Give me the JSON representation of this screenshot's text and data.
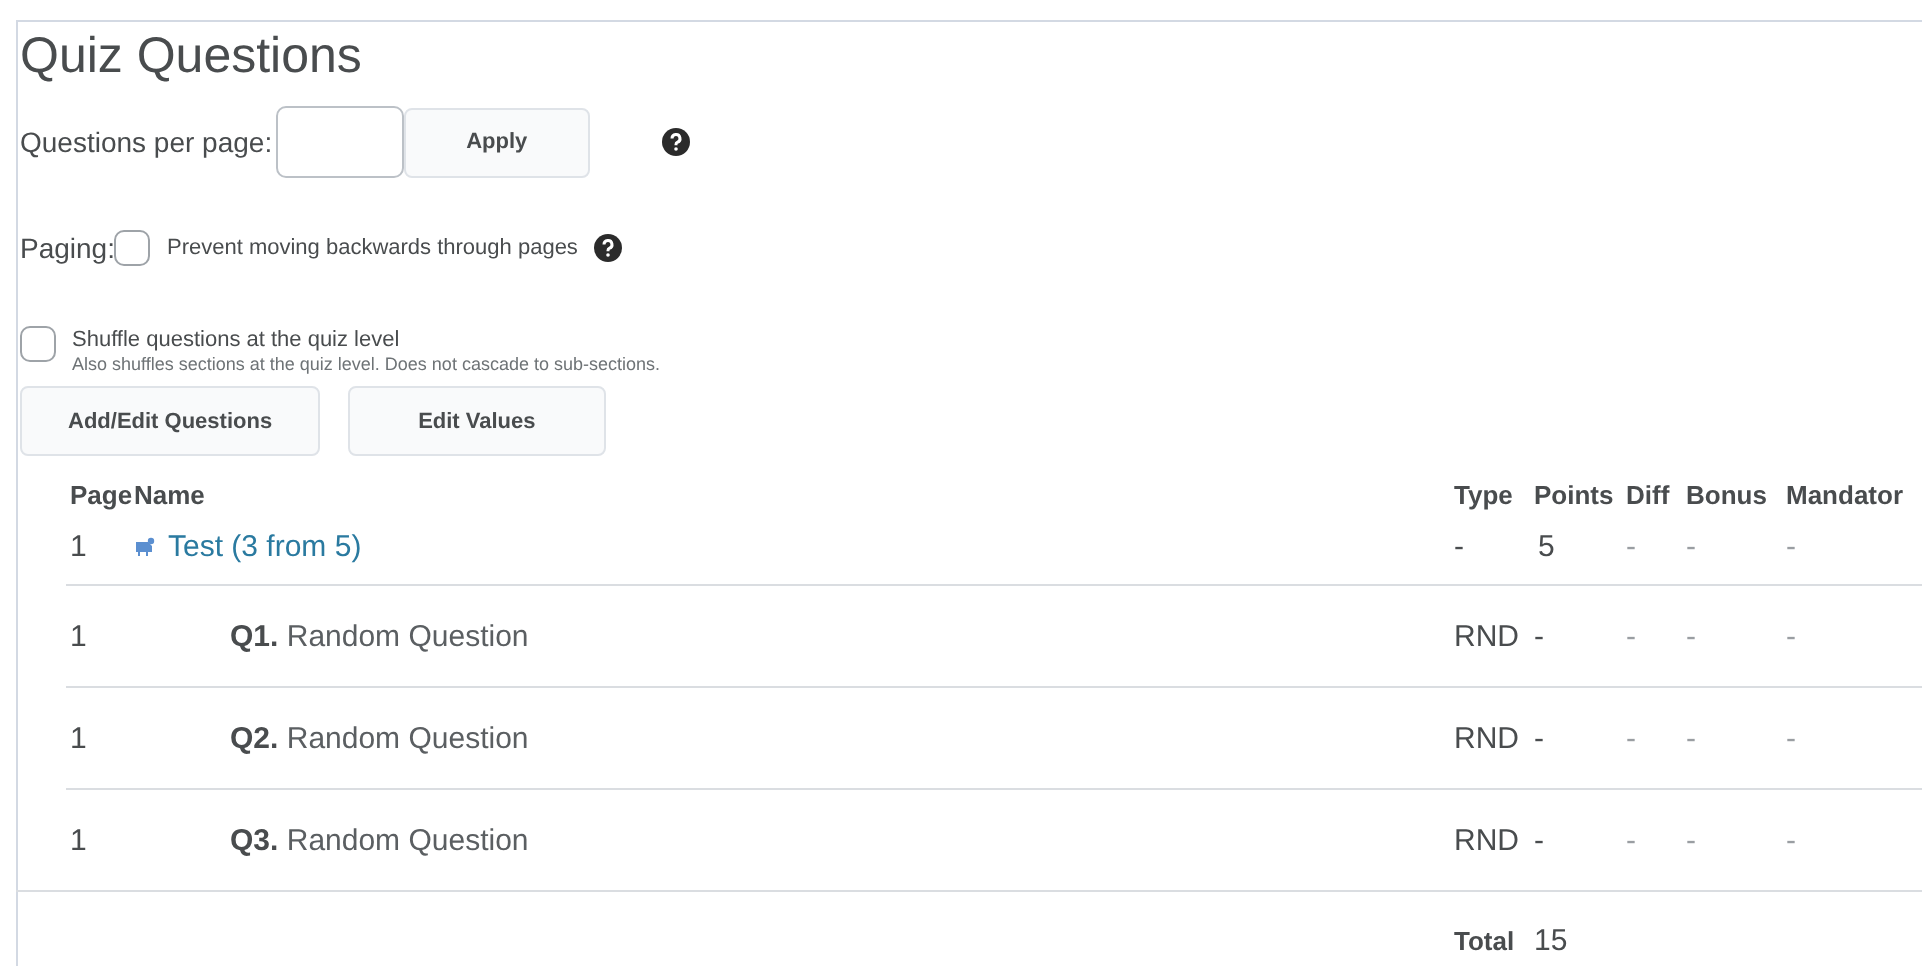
{
  "title": "Quiz Questions",
  "questions_per_page": {
    "label": "Questions per page:",
    "apply_button": "Apply"
  },
  "paging": {
    "label": "Paging:",
    "checked": false,
    "option": "Prevent moving backwards through pages"
  },
  "shuffle": {
    "checked": false,
    "label": "Shuffle questions at the quiz level",
    "description": "Also shuffles sections at the quiz level. Does not cascade to sub-sections."
  },
  "buttons": [
    "Add/Edit Questions",
    "Edit Values"
  ],
  "table": {
    "columns": [
      "Page",
      "Name",
      "Type",
      "Points",
      "Diff",
      "Bonus",
      "Mandator"
    ],
    "rows": [
      {
        "kind": "section",
        "page": "1",
        "name": "Test (3 from 5)",
        "type": "-",
        "points": "5",
        "diff": "-",
        "bonus": "-",
        "mandatory": "-"
      },
      {
        "kind": "question",
        "page": "1",
        "name": "**Q1.** Random Question",
        "type": "RND",
        "points": "-",
        "diff": "-",
        "bonus": "-",
        "mandatory": "-"
      },
      {
        "kind": "question",
        "page": "1",
        "name": "**Q2.** Random Question",
        "type": "RND",
        "points": "-",
        "diff": "-",
        "bonus": "-",
        "mandatory": "-"
      },
      {
        "kind": "question",
        "page": "1",
        "name": "**Q3.** Random Question",
        "type": "RND",
        "points": "-",
        "diff": "-",
        "bonus": "-",
        "mandatory": "-"
      }
    ],
    "total_label": "Total",
    "total_value": "15"
  }
}
